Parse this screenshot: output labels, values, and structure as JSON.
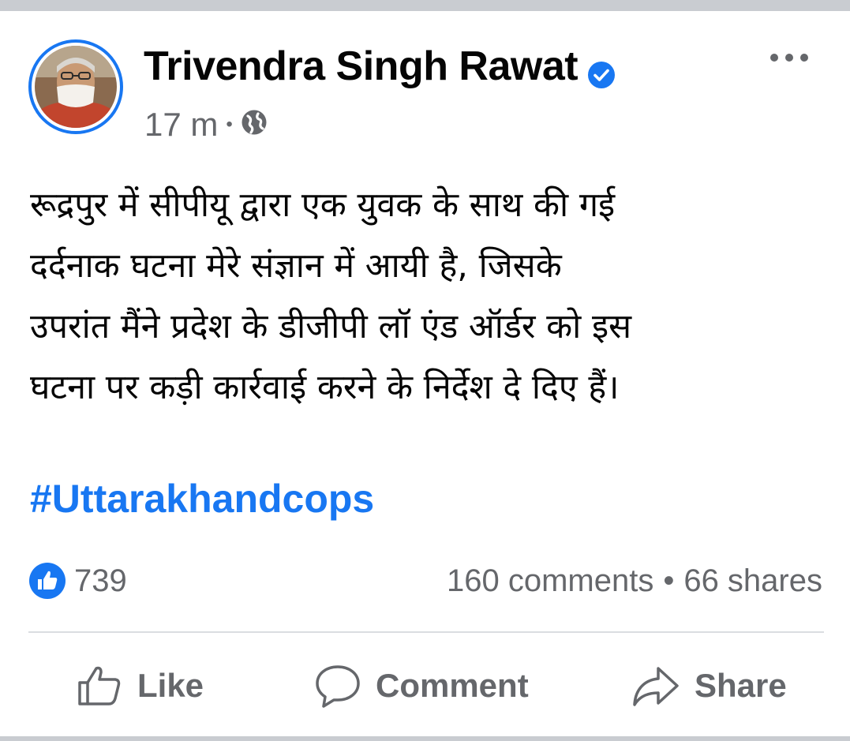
{
  "post": {
    "author": "Trivendra Singh Rawat",
    "time": "17 m",
    "separator": "•",
    "text_lines": [
      "रूद्रपुर में सीपीयू द्वारा एक युवक के साथ की गई",
      "दर्दनाक घटना मेरे संज्ञान में आयी है, जिसके",
      "उपरांत मैंने प्रदेश के डीजीपी लॉ एंड ऑर्डर को इस",
      "घटना पर कड़ी कार्रवाई करने के निर्देश दे दिए हैं।"
    ],
    "hashtag": "#Uttarakhandcops"
  },
  "stats": {
    "likes": "739",
    "comments": "160 comments",
    "separator": "•",
    "shares": "66 shares"
  },
  "actions": {
    "like_label": "Like",
    "comment_label": "Comment",
    "share_label": "Share"
  },
  "icons": {
    "verified": "verified-badge-icon",
    "audience": "globe-icon",
    "more": "more-options-icon",
    "like_reaction": "thumbs-up-reaction-icon",
    "like": "thumbs-up-icon",
    "comment": "speech-bubble-icon",
    "share": "share-arrow-icon"
  },
  "colors": {
    "accent": "#1877f2",
    "secondary_text": "#65676b",
    "separator_band": "#c9ccd1"
  }
}
